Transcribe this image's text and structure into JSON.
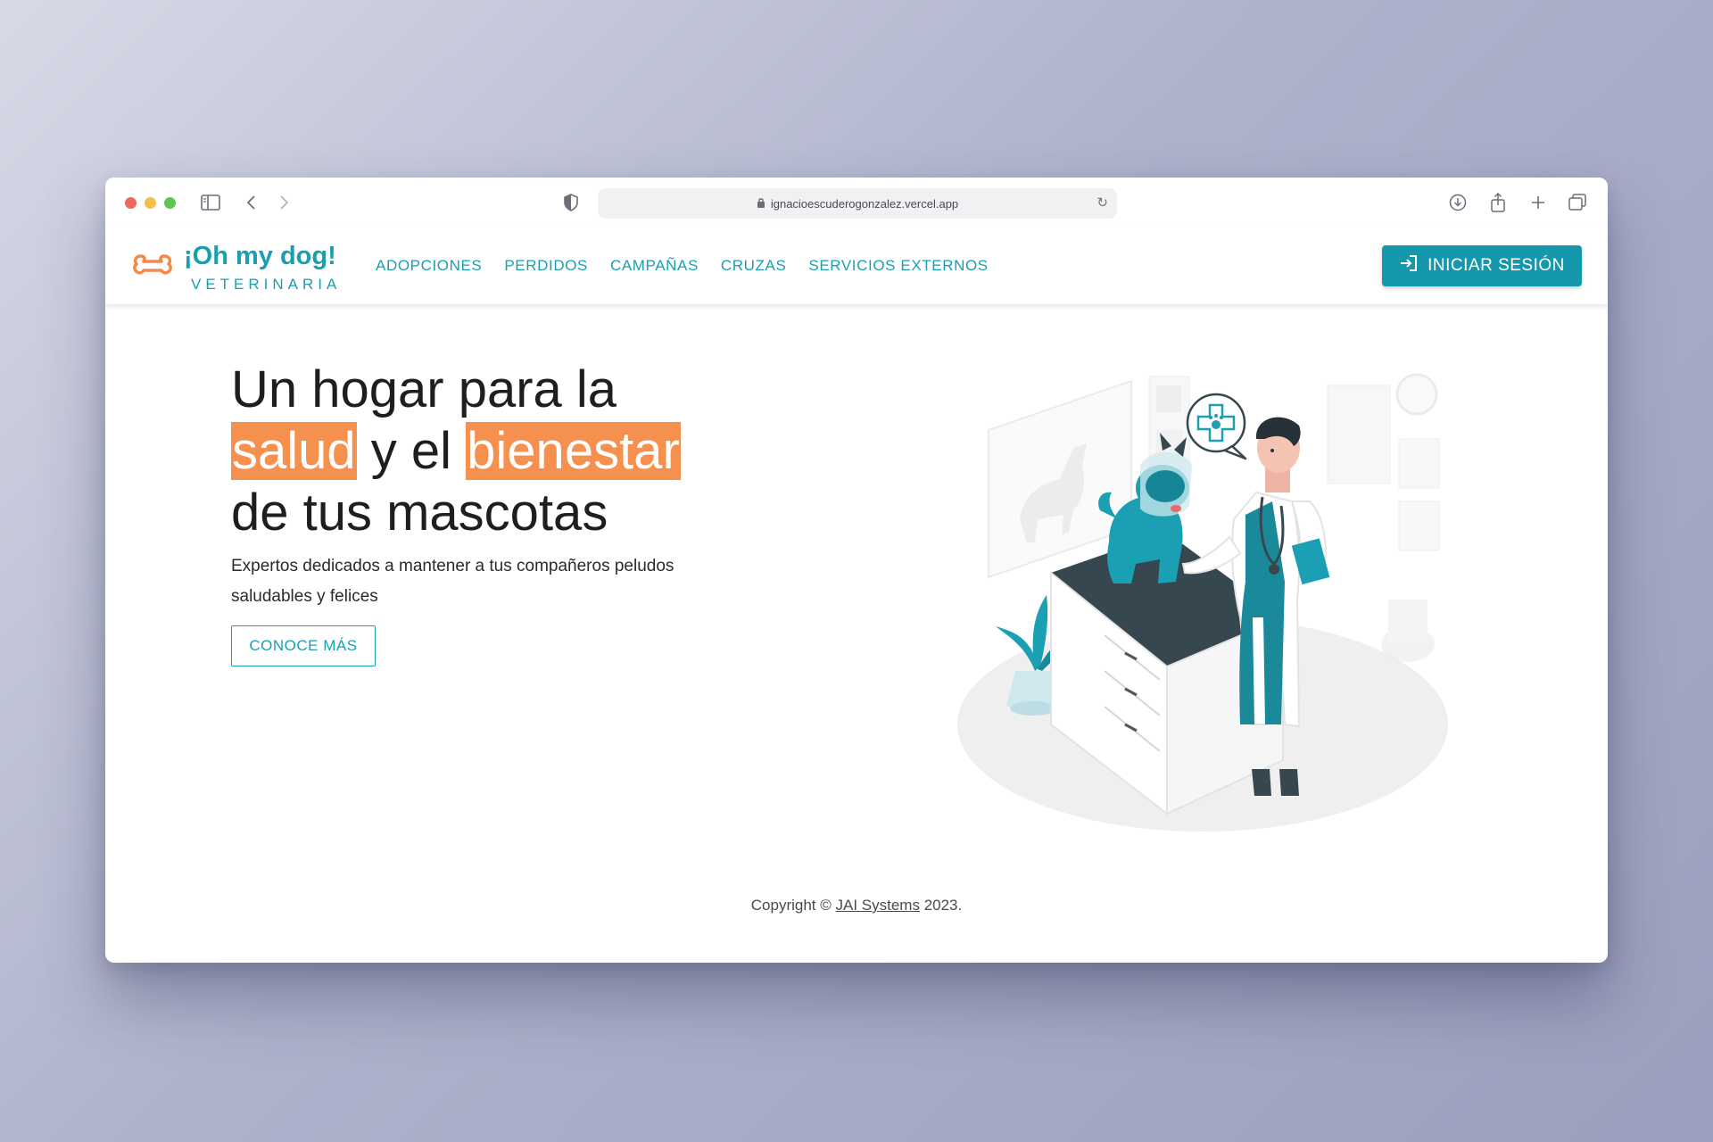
{
  "browser": {
    "url": "ignacioescuderogonzalez.vercel.app",
    "traffic_lights": [
      "#ed6a5e",
      "#f4bf4f",
      "#61c554"
    ]
  },
  "nav": {
    "brand": "¡Oh my dog!",
    "brand_sub": "VETERINARIA",
    "items": [
      "ADOPCIONES",
      "PERDIDOS",
      "CAMPAÑAS",
      "CRUZAS",
      "SERVICIOS EXTERNOS"
    ],
    "login_label": "INICIAR SESIÓN"
  },
  "hero": {
    "line1": "Un hogar para la",
    "highlight1": "salud",
    "mid": " y el ",
    "highlight2": "bienestar",
    "line3": "de tus mascotas",
    "description": "Expertos dedicados a mantener a tus compañeros peludos saludables y felices",
    "cta_label": "CONOCE MÁS"
  },
  "footer": {
    "prefix": "Copyright © ",
    "link": "JAI Systems",
    "suffix": " 2023."
  },
  "colors": {
    "accent": "#1a9fb1",
    "highlight": "#f6904f",
    "button": "#1598ab"
  }
}
